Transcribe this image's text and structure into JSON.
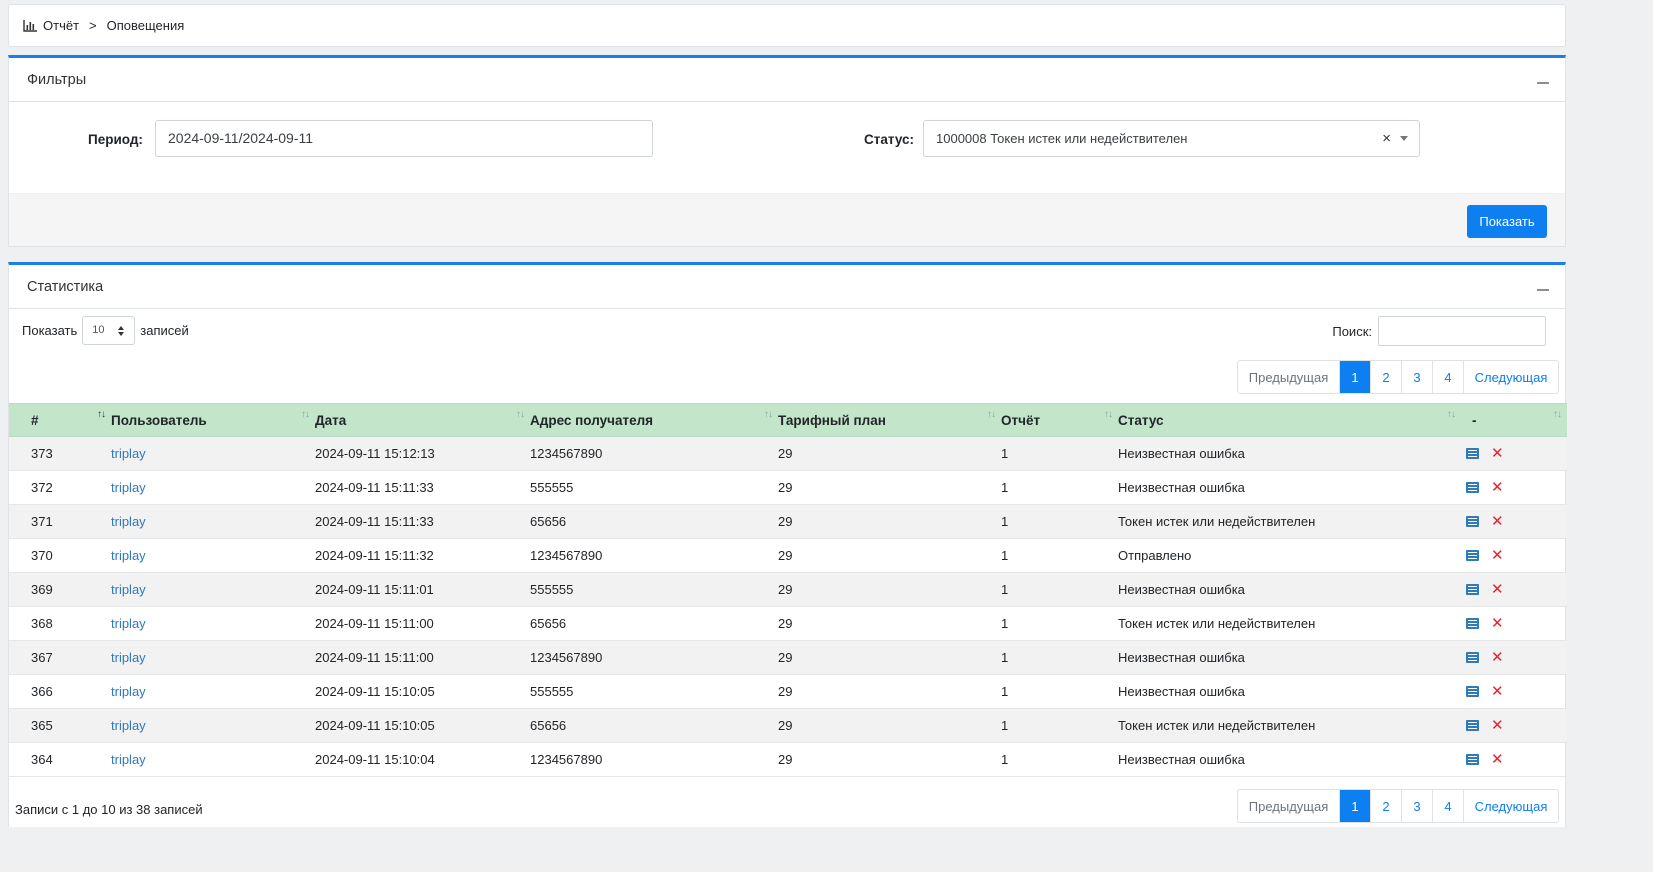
{
  "breadcrumb": {
    "icon": "bar-chart-icon",
    "items": [
      "Отчёт",
      "Оповещения"
    ],
    "separator": ">"
  },
  "filters": {
    "title": "Фильтры",
    "period_label": "Период:",
    "period_value": "2024-09-11/2024-09-11",
    "status_label": "Статус:",
    "status_value": "1000008 Токен истек или недействителен",
    "clear_symbol": "×",
    "submit_label": "Показать"
  },
  "stats": {
    "title": "Статистика",
    "length_prefix": "Показать",
    "length_value": "10",
    "length_suffix": "записей",
    "search_label": "Поиск:",
    "search_value": "",
    "pagination": {
      "prev": "Предыдущая",
      "pages": [
        "1",
        "2",
        "3",
        "4"
      ],
      "active": "1",
      "next": "Следующая"
    },
    "columns": [
      "#",
      "Пользователь",
      "Дата",
      "Адрес получателя",
      "Тарифный план",
      "Отчёт",
      "Статус",
      "-"
    ],
    "sorted_column": "#",
    "rows": [
      {
        "id": "373",
        "user": "triplay",
        "date": "2024-09-11 15:12:13",
        "address": "1234567890",
        "plan": "29",
        "report": "1",
        "status": "Неизвестная ошибка"
      },
      {
        "id": "372",
        "user": "triplay",
        "date": "2024-09-11 15:11:33",
        "address": "555555",
        "plan": "29",
        "report": "1",
        "status": "Неизвестная ошибка"
      },
      {
        "id": "371",
        "user": "triplay",
        "date": "2024-09-11 15:11:33",
        "address": "65656",
        "plan": "29",
        "report": "1",
        "status": "Токен истек или недействителен"
      },
      {
        "id": "370",
        "user": "triplay",
        "date": "2024-09-11 15:11:32",
        "address": "1234567890",
        "plan": "29",
        "report": "1",
        "status": "Отправлено"
      },
      {
        "id": "369",
        "user": "triplay",
        "date": "2024-09-11 15:11:01",
        "address": "555555",
        "plan": "29",
        "report": "1",
        "status": "Неизвестная ошибка"
      },
      {
        "id": "368",
        "user": "triplay",
        "date": "2024-09-11 15:11:00",
        "address": "65656",
        "plan": "29",
        "report": "1",
        "status": "Токен истек или недействителен"
      },
      {
        "id": "367",
        "user": "triplay",
        "date": "2024-09-11 15:11:00",
        "address": "1234567890",
        "plan": "29",
        "report": "1",
        "status": "Неизвестная ошибка"
      },
      {
        "id": "366",
        "user": "triplay",
        "date": "2024-09-11 15:10:05",
        "address": "555555",
        "plan": "29",
        "report": "1",
        "status": "Неизвестная ошибка"
      },
      {
        "id": "365",
        "user": "triplay",
        "date": "2024-09-11 15:10:05",
        "address": "65656",
        "plan": "29",
        "report": "1",
        "status": "Токен истек или недействителен"
      },
      {
        "id": "364",
        "user": "triplay",
        "date": "2024-09-11 15:10:04",
        "address": "1234567890",
        "plan": "29",
        "report": "1",
        "status": "Неизвестная ошибка"
      }
    ],
    "row_actions": [
      "details-icon",
      "delete-icon"
    ],
    "info_text": "Записи с 1 до 10 из 38 записей"
  },
  "colors": {
    "accent": "#0d7ff0",
    "header_row": "#c3e6cb",
    "link": "#2f7ab9",
    "delete": "#e0272d"
  }
}
